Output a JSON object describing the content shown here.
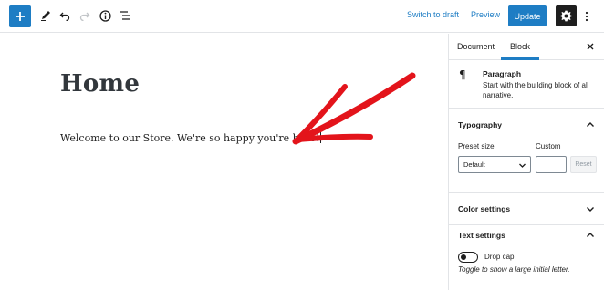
{
  "toolbar": {
    "add_icon": "plus-icon",
    "tools_icon": "pencil-icon",
    "undo_icon": "undo-icon",
    "redo_icon": "redo-icon",
    "info_icon": "info-icon",
    "outline_icon": "list-view-icon",
    "switch_to_draft": "Switch to draft",
    "preview": "Preview",
    "update": "Update",
    "settings_icon": "gear-icon",
    "more_icon": "more-vertical-icon"
  },
  "editor": {
    "title": "Home",
    "paragraph": "Welcome to our Store. We're so happy you're here!",
    "annotation": "red-arrow"
  },
  "sidebar": {
    "tabs": [
      {
        "label": "Document",
        "active": false
      },
      {
        "label": "Block",
        "active": true
      }
    ],
    "close_icon": "close-icon",
    "block": {
      "icon": "¶",
      "name": "Paragraph",
      "description": "Start with the building block of all narrative."
    },
    "typography": {
      "title": "Typography",
      "expanded": true,
      "preset_size_label": "Preset size",
      "preset_size_value": "Default",
      "custom_label": "Custom",
      "custom_value": "",
      "reset_label": "Reset"
    },
    "color_settings": {
      "title": "Color settings",
      "expanded": false
    },
    "text_settings": {
      "title": "Text settings",
      "expanded": true,
      "drop_cap_label": "Drop cap",
      "drop_cap_on": false,
      "help": "Toggle to show a large initial letter."
    }
  },
  "colors": {
    "accent": "#1e7dc4",
    "arrow": "#e3141b",
    "dark": "#1e1e1e",
    "border": "#e2e4e7"
  }
}
